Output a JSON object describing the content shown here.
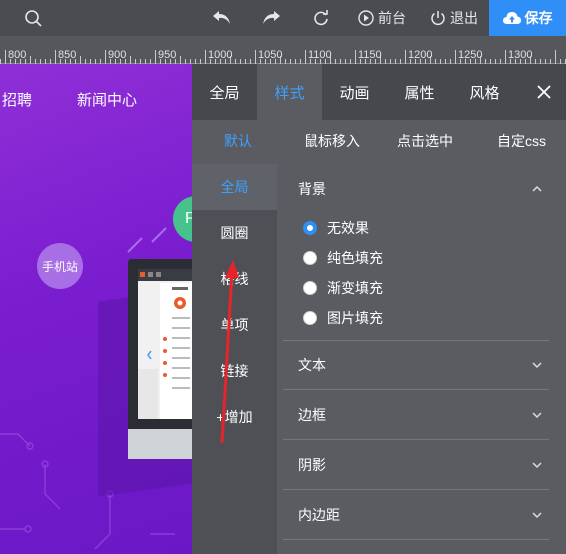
{
  "toolbar": {
    "frontend_label": "前台",
    "logout_label": "退出",
    "save_label": "保存"
  },
  "ruler": {
    "ticks": [
      "800",
      "850",
      "900",
      "950",
      "1000",
      "1050",
      "1100",
      "1150",
      "1200",
      "1250",
      "1300"
    ]
  },
  "canvas": {
    "nav": [
      "招聘",
      "新闻中心"
    ],
    "phone_label": "手机站",
    "green_label": "P"
  },
  "panel": {
    "tabs": [
      {
        "label": "全局",
        "active": false
      },
      {
        "label": "样式",
        "active": true
      },
      {
        "label": "动画",
        "active": false
      },
      {
        "label": "属性",
        "active": false
      },
      {
        "label": "风格",
        "active": false
      }
    ],
    "close_label": "X",
    "states": [
      {
        "label": "默认",
        "active": true
      },
      {
        "label": "鼠标移入",
        "active": false
      },
      {
        "label": "点击选中",
        "active": false
      },
      {
        "label": "自定css",
        "active": false
      }
    ],
    "side_items": [
      {
        "label": "全局",
        "active": true
      },
      {
        "label": "圆圈",
        "active": false
      },
      {
        "label": "格线",
        "active": false
      },
      {
        "label": "单项",
        "active": false
      },
      {
        "label": "链接",
        "active": false
      },
      {
        "label": "+增加",
        "active": false
      }
    ],
    "sections": {
      "background": {
        "label": "背景",
        "options": [
          {
            "label": "无效果",
            "checked": true
          },
          {
            "label": "纯色填充",
            "checked": false
          },
          {
            "label": "渐变填充",
            "checked": false
          },
          {
            "label": "图片填充",
            "checked": false
          }
        ]
      },
      "text": {
        "label": "文本"
      },
      "border": {
        "label": "边框"
      },
      "shadow": {
        "label": "阴影"
      },
      "padding": {
        "label": "内边距"
      }
    }
  },
  "colors": {
    "accent": "#3fa1ff",
    "save_bg": "#2f8ff7",
    "annotation": "#e8232a"
  }
}
